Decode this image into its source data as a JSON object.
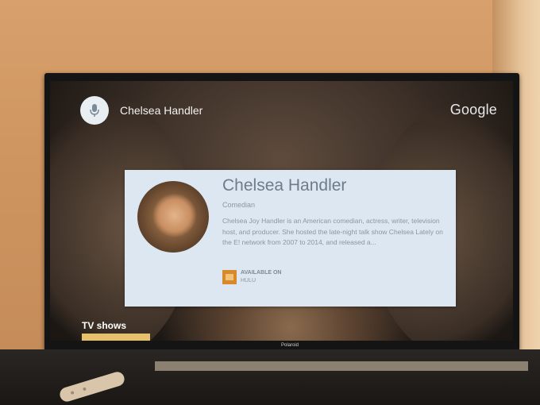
{
  "voice_search": {
    "mic_icon": "microphone-icon",
    "query": "Chelsea Handler",
    "brand": "Google"
  },
  "knowledge_card": {
    "title": "Chelsea Handler",
    "subtitle": "Comedian",
    "description": "Chelsea Joy Handler is an American comedian, actress, writer, television host, and producer. She hosted the late-night talk show Chelsea Lately on the E! network from 2007 to 2014, and released a...",
    "availability": {
      "line1": "AVAILABLE ON",
      "line2": "HULU",
      "logo": "hulu-logo"
    }
  },
  "tv_shows": {
    "label": "TV shows"
  },
  "tv": {
    "brand": "Polaroid"
  },
  "colors": {
    "card_bg": "#dce7f1",
    "card_title": "#6f7c88",
    "hulu_orange": "#d78a2a"
  }
}
